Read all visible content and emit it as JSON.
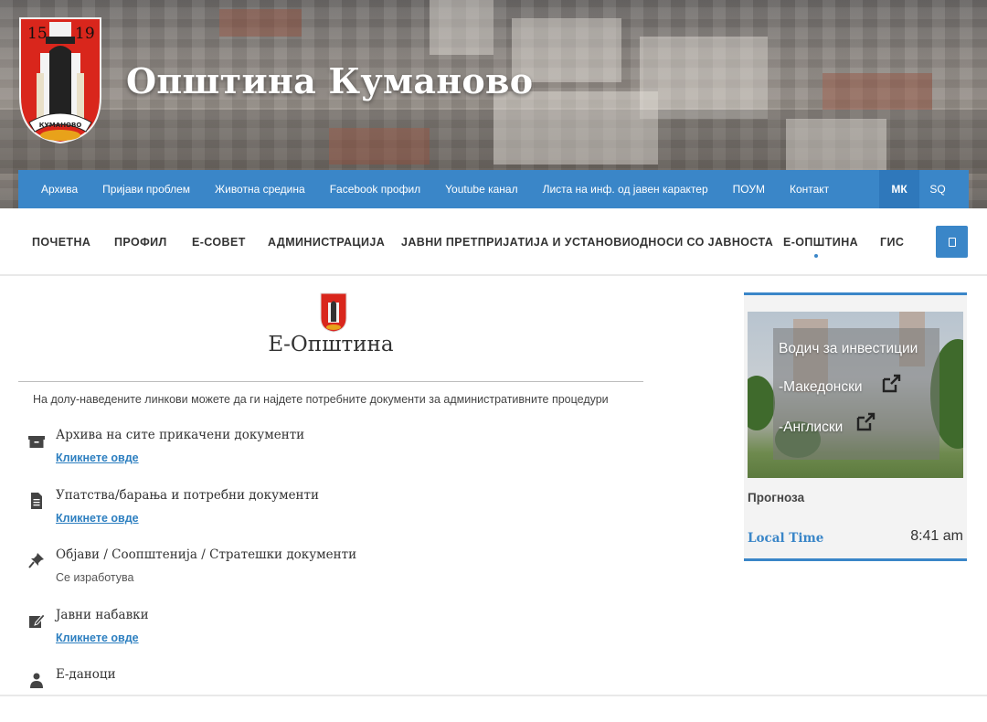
{
  "header": {
    "site_title": "Општина Куманово",
    "crest": {
      "year_left": "15",
      "year_right": "19",
      "label": "КУМАНОВО"
    }
  },
  "topbar": {
    "items": [
      "Архива",
      "Пријави проблем",
      "Животна средина",
      "Facebook профил",
      "Youtube канал",
      "Листа на инф. од јавен карактер",
      "ПОУМ",
      "Контакт"
    ],
    "languages": {
      "mk": "МК",
      "sq": "SQ"
    }
  },
  "mainnav": {
    "items": [
      "ПОЧЕТНА",
      "ПРОФИЛ",
      "Е-СОВЕТ",
      "АДМИНИСТРАЦИЈА",
      "ЈАВНИ ПРЕТПРИЈАТИЈА И УСТАНОВИ",
      "ОДНОСИ СО ЈАВНОСТА",
      "Е-ОПШТИНА",
      "ГИС"
    ],
    "active": "Е-ОПШТИНА",
    "search_icon": "search-icon"
  },
  "content": {
    "title": "Е-Општина",
    "intro": "На долу-наведените линкови можете да ги најдете потребните документи за административните процедури",
    "items": [
      {
        "icon": "archive-icon",
        "title": "Архива на сите прикачени документи",
        "link": "Кликнете овде"
      },
      {
        "icon": "document-icon",
        "title": "Упатства/барања и потребни документи",
        "link": "Кликнете овде"
      },
      {
        "icon": "pin-icon",
        "title": "Објави / Соопштенија / Стратешки документи",
        "note": "Се изработува"
      },
      {
        "icon": "edit-icon",
        "title": "Јавни набавки",
        "link": "Кликнете овде"
      },
      {
        "icon": "user-icon",
        "title": "Е-даноци"
      }
    ]
  },
  "sidebar": {
    "invest": {
      "heading": "Водич за инвестиции",
      "links": [
        "-Македонски",
        "-Англиски"
      ],
      "icon": "external-link-icon"
    },
    "forecast": "Прогноза",
    "local_time_label": "Local Time",
    "local_time_value": "8:41 am",
    "accent": "#3a86c8"
  }
}
